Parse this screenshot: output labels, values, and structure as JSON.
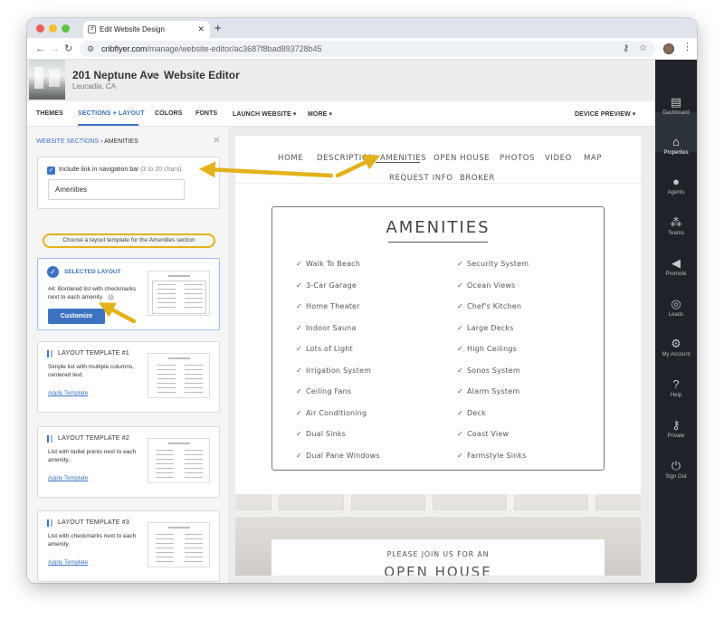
{
  "browser": {
    "tab_title": "Edit Website Design",
    "tab_favicon": "cribflyer-favicon",
    "new_tab": "+",
    "url_host": "cribflyer.com",
    "url_path": "/manage/website-editor/ac3687f8bad893728b45"
  },
  "header": {
    "address": "201 Neptune Ave",
    "page": "Website Editor",
    "city": "Leucadia, CA"
  },
  "menubar": {
    "items": [
      "THEMES",
      "SECTIONS + LAYOUT",
      "COLORS",
      "FONTS",
      "LAUNCH WEBSITE",
      "MORE"
    ],
    "device_preview": "DEVICE PREVIEW",
    "active": "SECTIONS + LAYOUT"
  },
  "left": {
    "breadcrumb_link": "WEBSITE SECTIONS",
    "breadcrumb_sep": "›",
    "breadcrumb_current": "AMENITIES",
    "nav_checkbox_label": "Include link in navigation bar",
    "nav_checkbox_hint": "(3 to 20 chars)",
    "nav_input_value": "Amenities",
    "choose_text": "Choose a layout template for the Amenities section",
    "selected": {
      "title": "SELECTED LAYOUT",
      "desc": "#4: Bordered list with checkmarks next to each amenity.",
      "button": "Customize"
    },
    "templates": [
      {
        "title": "LAYOUT TEMPLATE #1",
        "desc": "Simple list with multiple columns, centered text.",
        "apply": "Apply Template"
      },
      {
        "title": "LAYOUT TEMPLATE #2",
        "desc": "List with bullet points next to each amenity..",
        "apply": "Apply Template"
      },
      {
        "title": "LAYOUT TEMPLATE #3",
        "desc": "List with checkmarks next to each amenity.",
        "apply": "Apply Template"
      }
    ]
  },
  "preview": {
    "nav": [
      "HOME",
      "DESCRIPTION",
      "AMENITIES",
      "OPEN HOUSE",
      "PHOTOS",
      "VIDEO",
      "MAP",
      "REQUEST INFO",
      "BROKER"
    ],
    "section_title": "AMENITIES",
    "amenities_left": [
      "Walk To Beach",
      "3-Car Garage",
      "Home Theater",
      "Indoor Sauna",
      "Lots of Light",
      "Irrigation System",
      "Ceiling Fans",
      "Air Conditioning",
      "Dual Sinks",
      "Dual Pane Windows"
    ],
    "amenities_right": [
      "Security System",
      "Ocean Views",
      "Chef's Kitchen",
      "Large Decks",
      "High Ceilings",
      "Sonos System",
      "Alarm System",
      "Deck",
      "Coast View",
      "Farmstyle Sinks"
    ],
    "open_house_sub": "PLEASE JOIN US FOR AN",
    "open_house_title": "OPEN HOUSE"
  },
  "rail": [
    {
      "label": "Dashboard",
      "icon": "dashboard-icon"
    },
    {
      "label": "Properties",
      "icon": "properties-icon"
    },
    {
      "label": "Agents",
      "icon": "agent-icon"
    },
    {
      "label": "Teams",
      "icon": "teams-icon"
    },
    {
      "label": "Promote",
      "icon": "megaphone-icon"
    },
    {
      "label": "Leads",
      "icon": "target-icon"
    },
    {
      "label": "My Account",
      "icon": "gear-icon"
    },
    {
      "label": "Help",
      "icon": "help-icon"
    },
    {
      "label": "Private",
      "icon": "key-icon"
    },
    {
      "label": "Sign Out",
      "icon": "power-icon"
    }
  ],
  "colors": {
    "accent": "#3e73c2",
    "annotation": "#e2b21a",
    "rail": "#1f2329"
  }
}
